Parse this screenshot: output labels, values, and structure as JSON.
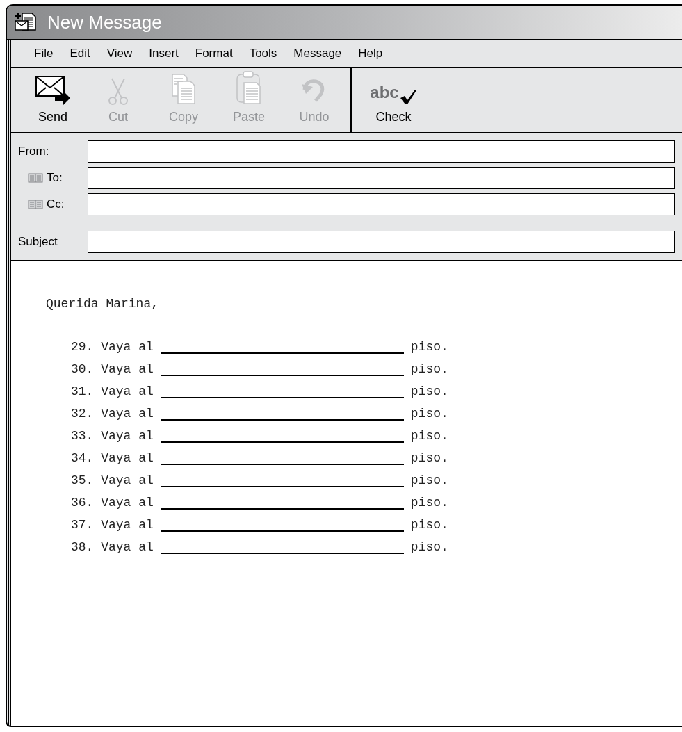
{
  "window": {
    "title": "New Message"
  },
  "menu": [
    "File",
    "Edit",
    "View",
    "Insert",
    "Format",
    "Tools",
    "Message",
    "Help"
  ],
  "toolbar": [
    {
      "kind": "send",
      "label": "Send",
      "disabled": false
    },
    {
      "kind": "cut",
      "label": "Cut",
      "disabled": true
    },
    {
      "kind": "copy",
      "label": "Copy",
      "disabled": true
    },
    {
      "kind": "paste",
      "label": "Paste",
      "disabled": true
    },
    {
      "kind": "undo",
      "label": "Undo",
      "disabled": true
    },
    {
      "kind": "check",
      "label": "Check",
      "glyph": "abc",
      "disabled": false
    }
  ],
  "fields": [
    {
      "label": "From:",
      "kind": "plain"
    },
    {
      "label": "To:",
      "kind": "address"
    },
    {
      "label": "Cc:",
      "kind": "address"
    },
    {
      "label": "Subject",
      "kind": "subject"
    }
  ],
  "body": {
    "greeting": "Querida Marina,",
    "lines": [
      {
        "number": "29.",
        "before": "Vaya al",
        "after": "piso."
      },
      {
        "number": "30.",
        "before": "Vaya al",
        "after": "piso."
      },
      {
        "number": "31.",
        "before": "Vaya al",
        "after": "piso."
      },
      {
        "number": "32.",
        "before": "Vaya al",
        "after": "piso."
      },
      {
        "number": "33.",
        "before": "Vaya al",
        "after": "piso."
      },
      {
        "number": "34.",
        "before": "Vaya al",
        "after": "piso."
      },
      {
        "number": "35.",
        "before": "Vaya al",
        "after": "piso."
      },
      {
        "number": "36.",
        "before": "Vaya al",
        "after": "piso."
      },
      {
        "number": "37.",
        "before": "Vaya al",
        "after": "piso."
      },
      {
        "number": "38.",
        "before": "Vaya al",
        "after": "piso."
      }
    ]
  }
}
